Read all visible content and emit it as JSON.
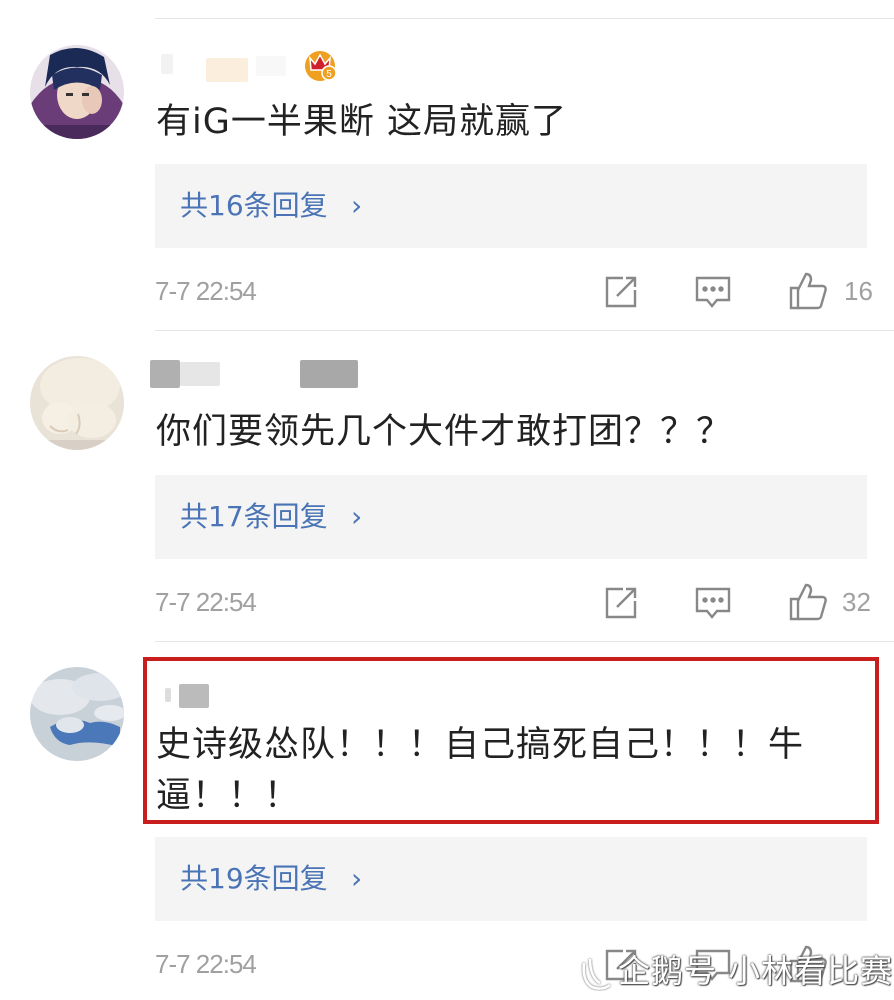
{
  "comments": [
    {
      "text": "有iG一半果断 这局就赢了",
      "reply_label": "共16条回复",
      "time": "7-7 22:54",
      "likes": "16"
    },
    {
      "text": "你们要领先几个大件才敢打团？？？",
      "reply_label": "共17条回复",
      "time": "7-7 22:54",
      "likes": "32"
    },
    {
      "text_line1": "史诗级怂队！！！自己搞死自己！！！牛",
      "text_line2": "逼！！！",
      "reply_label": "共19条回复",
      "time": "7-7 22:54"
    }
  ],
  "chevron": "›",
  "colors": {
    "reply_link": "#4a74b5",
    "highlight_border": "#c81e1e",
    "crown": "#f0a020"
  },
  "watermark": "企鹅号 小林看比赛",
  "icons": [
    "share-icon",
    "comment-icon",
    "thumbs-up-icon",
    "crown-vip-icon"
  ]
}
